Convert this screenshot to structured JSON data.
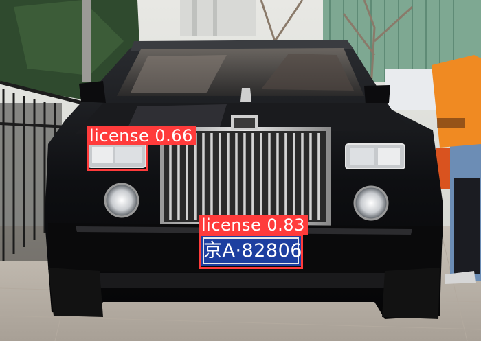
{
  "photo": {
    "subject": "car-front",
    "plate_text": "京A·82806"
  },
  "detections": [
    {
      "label": "license",
      "score": "0.66",
      "text": "license 0.66",
      "color": "#ff3b3b"
    },
    {
      "label": "license",
      "score": "0.83",
      "text": "license 0.83",
      "color": "#ff3b3b"
    }
  ]
}
